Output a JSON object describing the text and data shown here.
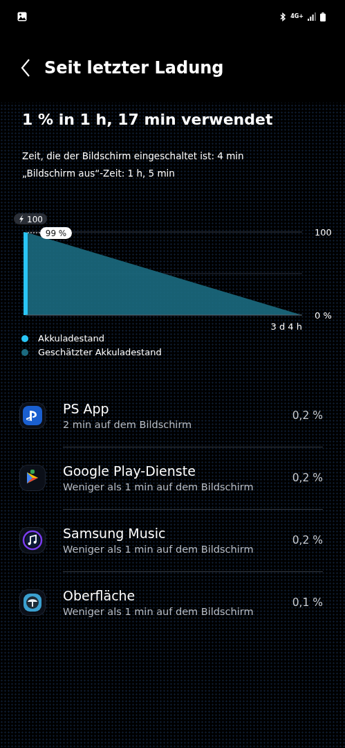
{
  "status_bar": {
    "network": "4G+"
  },
  "header": {
    "title": "Seit letzter Ladung"
  },
  "summary": {
    "headline": "1 % in 1 h, 17 min verwendet",
    "lines": [
      "Zeit, die der Bildschirm eingeschaltet ist: 4 min",
      "„Bildschirm aus“-Zeit: 1 h, 5 min"
    ]
  },
  "chart": {
    "charge_badge": "100",
    "level_badge": "99 %",
    "y_labels": [
      "100",
      "0 %"
    ],
    "x_label": "3 d 4 h"
  },
  "legend": [
    {
      "label": "Akkuladestand",
      "color": "#29c5f6"
    },
    {
      "label": "Geschätzter Akkuladestand",
      "color": "#1b6a80"
    }
  ],
  "apps": [
    {
      "name": "PS App",
      "detail": "2 min auf dem Bildschirm",
      "usage": "0,2 %"
    },
    {
      "name": "Google Play-Dienste",
      "detail": "Weniger als 1 min auf dem Bildschirm",
      "usage": "0,2 %"
    },
    {
      "name": "Samsung Music",
      "detail": "Weniger als 1 min auf dem Bildschirm",
      "usage": "0,2 %"
    },
    {
      "name": "Oberfläche",
      "detail": "Weniger als 1 min auf dem Bildschirm",
      "usage": "0,1 %"
    }
  ]
}
